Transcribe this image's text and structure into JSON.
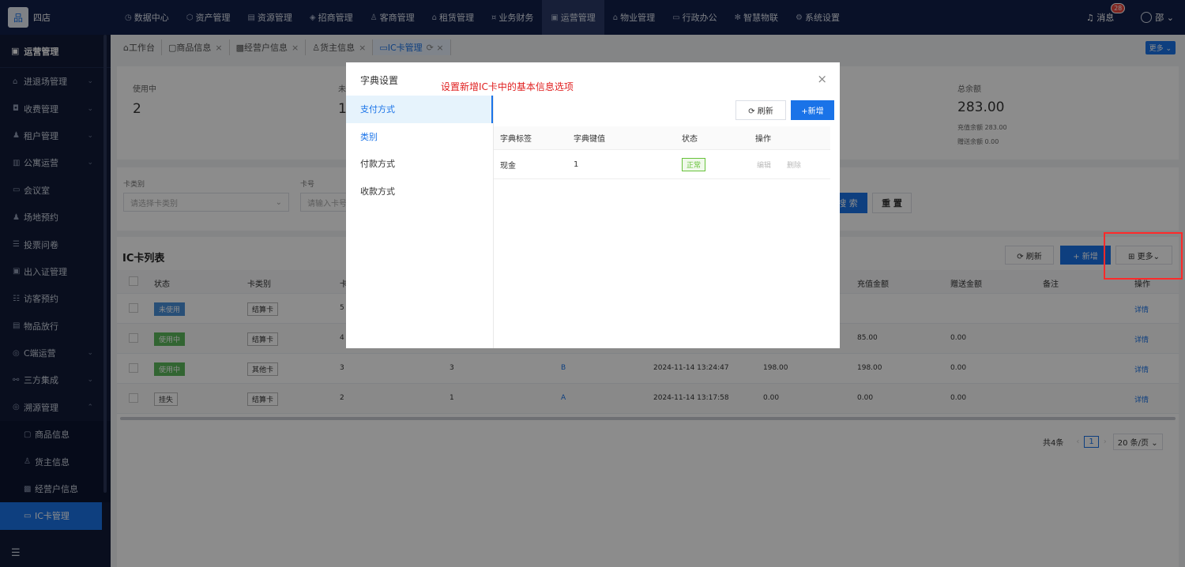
{
  "app": {
    "logo_text": "品",
    "brand": "四店"
  },
  "nav": [
    {
      "icon": "◷",
      "label": "数据中心"
    },
    {
      "icon": "⬡",
      "label": "资产管理"
    },
    {
      "icon": "▤",
      "label": "资源管理"
    },
    {
      "icon": "◈",
      "label": "招商管理"
    },
    {
      "icon": "♙",
      "label": "客商管理"
    },
    {
      "icon": "⌂",
      "label": "租赁管理"
    },
    {
      "icon": "¤",
      "label": "业务财务"
    },
    {
      "icon": "▣",
      "label": "运营管理"
    },
    {
      "icon": "⌂",
      "label": "物业管理"
    },
    {
      "icon": "▭",
      "label": "行政办公"
    },
    {
      "icon": "✻",
      "label": "智慧物联"
    },
    {
      "icon": "⚙",
      "label": "系统设置"
    }
  ],
  "top_right": {
    "msg_label": "消息",
    "msg_count": "28",
    "user": "邵"
  },
  "sidebar": {
    "title": "运营管理",
    "items": [
      {
        "icon": "⌂",
        "label": "进退场管理",
        "chevron": "⌄"
      },
      {
        "icon": "◘",
        "label": "收费管理",
        "chevron": "⌄"
      },
      {
        "icon": "♟",
        "label": "租户管理",
        "chevron": "⌄"
      },
      {
        "icon": "▥",
        "label": "公寓运营",
        "chevron": "⌄"
      },
      {
        "icon": "▭",
        "label": "会议室",
        "chevron": ""
      },
      {
        "icon": "♟",
        "label": "场地预约",
        "chevron": ""
      },
      {
        "icon": "☰",
        "label": "投票问卷",
        "chevron": ""
      },
      {
        "icon": "▣",
        "label": "出入证管理",
        "chevron": ""
      },
      {
        "icon": "☷",
        "label": "访客预约",
        "chevron": ""
      },
      {
        "icon": "▤",
        "label": "物品放行",
        "chevron": ""
      },
      {
        "icon": "◎",
        "label": "C端运营",
        "chevron": "⌄"
      },
      {
        "icon": "⚯",
        "label": "三方集成",
        "chevron": "⌄"
      },
      {
        "icon": "◎",
        "label": "溯源管理",
        "chevron": "⌃"
      }
    ],
    "sub_items": [
      {
        "icon": "▢",
        "label": "商品信息"
      },
      {
        "icon": "♙",
        "label": "货主信息"
      },
      {
        "icon": "▩",
        "label": "经营户信息"
      },
      {
        "icon": "▭",
        "label": "IC卡管理"
      }
    ],
    "collapse_icon": "☰"
  },
  "tabs": [
    {
      "icon": "⌂",
      "label": "工作台",
      "x": ""
    },
    {
      "icon": "▢",
      "label": "商品信息",
      "x": "×"
    },
    {
      "icon": "▩",
      "label": "经营户信息",
      "x": "×"
    },
    {
      "icon": "♙",
      "label": "货主信息",
      "x": "×"
    },
    {
      "icon": "▭",
      "label": "IC卡管理",
      "x": "⟳ ×"
    }
  ],
  "more_top": "更多 ⌄",
  "stats": {
    "in_use_label": "使用中",
    "in_use_val": "2",
    "unused_label": "未",
    "unused_val": "1",
    "total_label": "总余额",
    "total_val": "283.00",
    "recharge_line": "充值余额 283.00",
    "gift_line": "赠送余额 0.00"
  },
  "filter": {
    "card_type_label": "卡类别",
    "card_type_placeholder": "请选择卡类别",
    "card_no_label": "卡号",
    "card_no_placeholder": "请输入卡号",
    "search": "搜 索",
    "reset": "重 置"
  },
  "list": {
    "title": "IC卡列表",
    "refresh": "⟳ 刷新",
    "add": "+ 新增",
    "more": "⊞ 更多⌄",
    "headers": [
      "状态",
      "卡类别",
      "卡",
      "充值金额",
      "赠送金额",
      "备注",
      "操作"
    ],
    "rows": [
      {
        "status": "未使用",
        "status_type": "blue",
        "type": "结算卡",
        "c1": "5",
        "c2": "",
        "c3": "",
        "c4": "",
        "c5": "",
        "recharge": "",
        "gift": "",
        "action": "详情"
      },
      {
        "status": "使用中",
        "status_type": "green",
        "type": "结算卡",
        "c1": "4",
        "c2": "",
        "c3": "",
        "c4": "",
        "c5": "",
        "recharge": "85.00",
        "gift": "0.00",
        "action": "详情"
      },
      {
        "status": "使用中",
        "status_type": "green",
        "type": "其他卡",
        "c1": "3",
        "c2": "3",
        "c3": "B",
        "c4": "2024-11-14 13:24:47",
        "c5": "198.00",
        "recharge": "198.00",
        "gift": "0.00",
        "action": "详情"
      },
      {
        "status": "挂失",
        "status_type": "plain",
        "type": "结算卡",
        "c1": "2",
        "c2": "1",
        "c3": "A",
        "c4": "2024-11-14 13:17:58",
        "c5": "0.00",
        "recharge": "0.00",
        "gift": "0.00",
        "action": "详情"
      }
    ]
  },
  "pagination": {
    "total": "共4条",
    "page": "1",
    "prev": "‹",
    "next": "›",
    "size": "20 条/页 ⌄"
  },
  "modal": {
    "title": "字典设置",
    "note": "设置新增IC卡中的基本信息选项",
    "close": "×",
    "left_items": [
      "支付方式",
      "类别",
      "付款方式",
      "收款方式"
    ],
    "refresh": "⟳ 刷新",
    "add": "+新增",
    "headers": [
      "字典标签",
      "字典键值",
      "状态",
      "操作"
    ],
    "row": {
      "label": "现金",
      "value": "1",
      "status": "正常",
      "edit": "编辑",
      "delete": "删除"
    }
  }
}
